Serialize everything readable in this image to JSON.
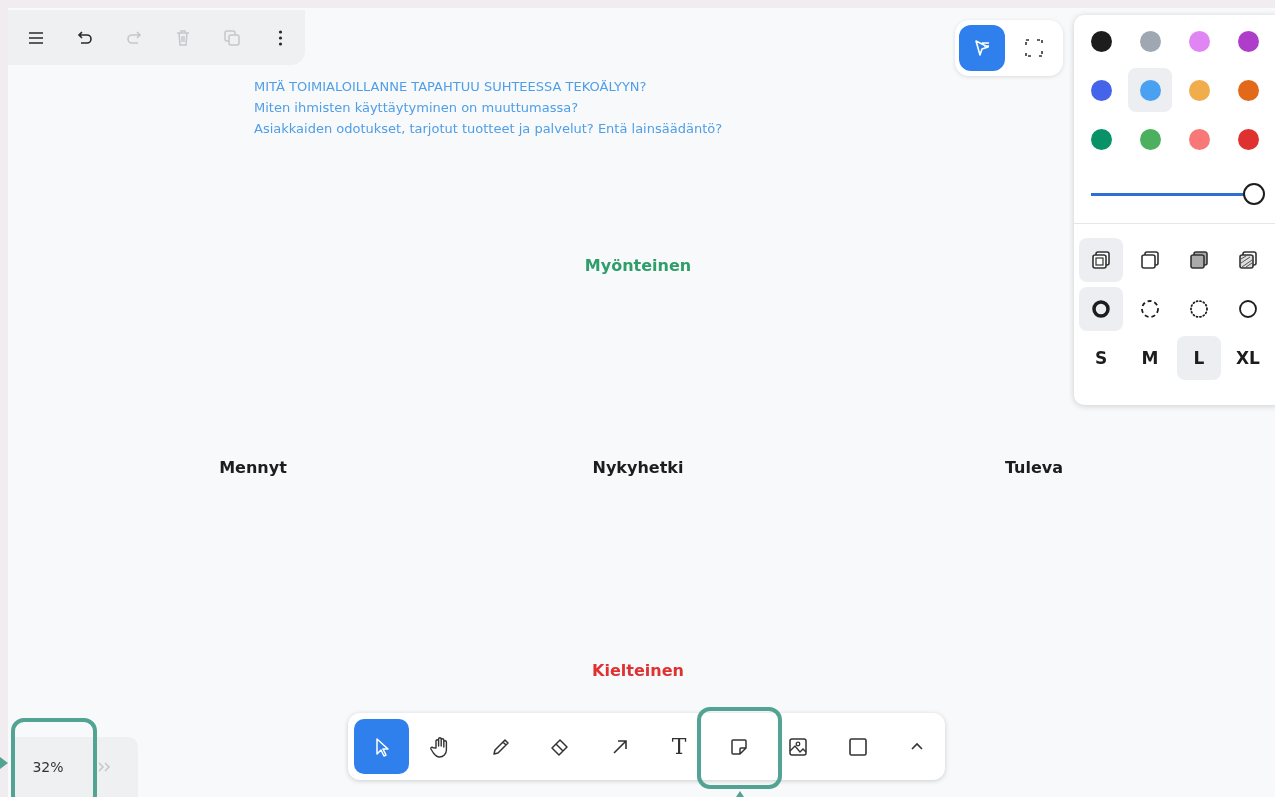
{
  "menu_bar": [
    {
      "kind": "menu",
      "disabled": false
    },
    {
      "kind": "undo",
      "disabled": false
    },
    {
      "kind": "redo",
      "disabled": true
    },
    {
      "kind": "delete",
      "disabled": true
    },
    {
      "kind": "duplicate",
      "disabled": true
    },
    {
      "kind": "more",
      "disabled": false
    }
  ],
  "prompt": {
    "text": "MITÄ TOIMIALOILLANNE TAPAHTUU SUHTEESSA TEKOÄLYYN?\nMiten ihmisten käyttäytyminen on muuttumassa?\nAsiakkaiden odotukset, tarjotut tuotteet ja palvelut? Entä lainsäädäntö?",
    "color": "#4f9ee8"
  },
  "axis_labels": {
    "top": {
      "text": "Myönteinen",
      "color": "#2f9e6a"
    },
    "left": {
      "text": "Mennyt",
      "color": "#1d1d1d"
    },
    "center": {
      "text": "Nykyhetki",
      "color": "#1d1d1d"
    },
    "right": {
      "text": "Tuleva",
      "color": "#1d1d1d"
    },
    "bottom": {
      "text": "Kielteinen",
      "color": "#e03131"
    }
  },
  "mode_buttons": [
    {
      "kind": "select-mode",
      "selected": true
    },
    {
      "kind": "focus",
      "selected": false
    }
  ],
  "style_panel": {
    "colors": [
      {
        "color": "#1d1d1d",
        "selected": false
      },
      {
        "color": "#9fa8b2",
        "selected": false
      },
      {
        "color": "#e085f4",
        "selected": false
      },
      {
        "color": "#ae3ec9",
        "selected": false
      },
      {
        "color": "#4465e9",
        "selected": false
      },
      {
        "color": "#4ba1f1",
        "selected": true
      },
      {
        "color": "#f1ac4b",
        "selected": false
      },
      {
        "color": "#e16919",
        "selected": false
      },
      {
        "color": "#099268",
        "selected": false
      },
      {
        "color": "#4cb05e",
        "selected": false
      },
      {
        "color": "#f87777",
        "selected": false
      },
      {
        "color": "#e03131",
        "selected": false
      }
    ],
    "opacity": {
      "level": 1
    },
    "fills": [
      {
        "kind": "none",
        "selected": true
      },
      {
        "kind": "semi",
        "selected": false
      },
      {
        "kind": "solid",
        "selected": false
      },
      {
        "kind": "pattern",
        "selected": false
      }
    ],
    "dashes": [
      {
        "kind": "draw",
        "selected": true
      },
      {
        "kind": "dashed",
        "selected": false
      },
      {
        "kind": "dotted",
        "selected": false
      },
      {
        "kind": "solid",
        "selected": false
      }
    ],
    "sizes": [
      {
        "label": "S",
        "selected": false
      },
      {
        "label": "M",
        "selected": false
      },
      {
        "label": "L",
        "selected": true
      },
      {
        "label": "XL",
        "selected": false
      }
    ]
  },
  "zoom": {
    "value": "32%",
    "highlighted": true
  },
  "tools": [
    {
      "kind": "select",
      "selected": true,
      "highlighted": false
    },
    {
      "kind": "hand",
      "selected": false,
      "highlighted": false
    },
    {
      "kind": "draw",
      "selected": false,
      "highlighted": false
    },
    {
      "kind": "eraser",
      "selected": false,
      "highlighted": false
    },
    {
      "kind": "arrow",
      "selected": false,
      "highlighted": false
    },
    {
      "kind": "text",
      "selected": false,
      "highlighted": false,
      "label": "T"
    },
    {
      "kind": "note",
      "selected": false,
      "highlighted": true
    },
    {
      "kind": "image",
      "selected": false,
      "highlighted": false
    },
    {
      "kind": "rectangle",
      "selected": false,
      "highlighted": false
    },
    {
      "kind": "more",
      "selected": false,
      "highlighted": false
    }
  ]
}
